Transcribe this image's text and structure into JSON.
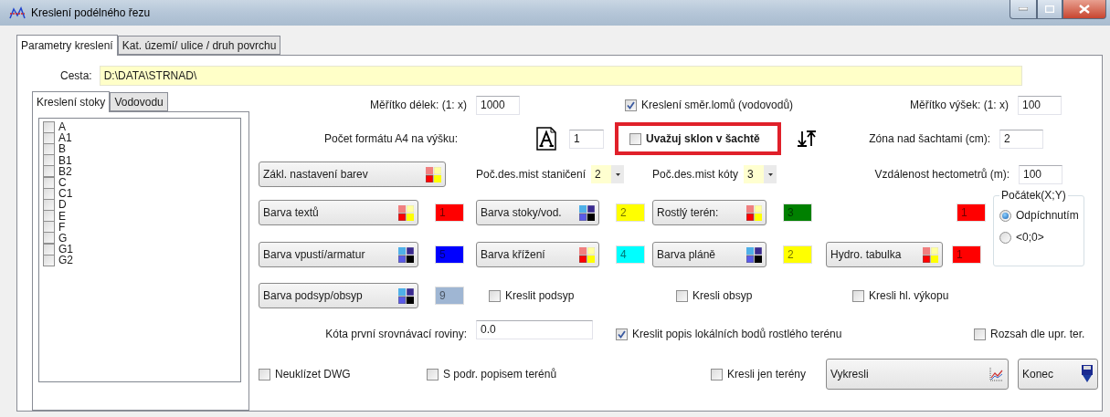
{
  "window": {
    "title": "Kreslení podélného řezu"
  },
  "tabs": [
    {
      "label": "Parametry kreslení",
      "selected": true
    },
    {
      "label": "Kat. území/ ulice / druh povrchu",
      "selected": false
    }
  ],
  "path": {
    "label": "Cesta:",
    "value": "D:\\DATA\\STRNAD\\"
  },
  "side_tabs": [
    {
      "label": "Kreslení  stoky",
      "selected": true
    },
    {
      "label": "Vodovodu",
      "selected": false
    }
  ],
  "layers": [
    {
      "label": "A",
      "checked": false
    },
    {
      "label": "A1",
      "checked": false
    },
    {
      "label": "B",
      "checked": false
    },
    {
      "label": "B1",
      "checked": false
    },
    {
      "label": "B2",
      "checked": false
    },
    {
      "label": "C",
      "checked": false
    },
    {
      "label": "C1",
      "checked": false
    },
    {
      "label": "D",
      "checked": false
    },
    {
      "label": "E",
      "checked": false
    },
    {
      "label": "F",
      "checked": false
    },
    {
      "label": "G",
      "checked": false
    },
    {
      "label": "G1",
      "checked": false
    },
    {
      "label": "G2",
      "checked": false
    }
  ],
  "scale_length": {
    "label": "Měřítko délek: (1:  x)",
    "value": "1000"
  },
  "direction_breaks": {
    "label": "Kreslení směr.lomů (vodovodů)",
    "checked": true
  },
  "scale_height": {
    "label": "Měřítko výšek: (1:  x)",
    "value": "100"
  },
  "a4_count": {
    "label": "Počet formátu A4 na výšku:",
    "value": "1"
  },
  "shaft_slope": {
    "label": "Uvažuj sklon v šachtě",
    "checked": false,
    "highlighted": true
  },
  "zone": {
    "label": "Zóna nad šachtami (cm):",
    "value": "2"
  },
  "base_colors_button": {
    "label": "Zákl. nastavení barev",
    "kind": "warm"
  },
  "station_decimals": {
    "label": "Poč.des.mist staničení",
    "value": "2"
  },
  "elevation_decimals": {
    "label": "Poč.des.mist kóty",
    "value": "3"
  },
  "hectometer": {
    "label": "Vzdálenost hectometrů (m):",
    "value": "100"
  },
  "color_rows": [
    [
      {
        "button": "Barva textů",
        "kind": "warm",
        "swatch": "1",
        "color": "#ff0000"
      },
      {
        "button": "Barva stoky/vod.",
        "kind": "cool",
        "swatch": "2",
        "color": "#ffff00"
      },
      {
        "button": "Rostlý terén:",
        "kind": "warm",
        "swatch": "3",
        "color": "#008000"
      },
      {
        "swatch": "1",
        "color": "#ff0000"
      }
    ],
    [
      {
        "button": "Barva vpustí/armatur",
        "kind": "cool",
        "swatch": "5",
        "color": "#0000ff"
      },
      {
        "button": "Barva křížení",
        "kind": "warm",
        "swatch": "4",
        "color": "#00ffff"
      },
      {
        "button": "Barva pláně",
        "kind": "cool",
        "swatch": "2",
        "color": "#ffff00"
      },
      {
        "button": "Hydro. tabulka",
        "kind": "warm",
        "swatch": "1",
        "color": "#ff0000"
      }
    ]
  ],
  "origin": {
    "title": "Počátek(X;Y)",
    "options": [
      {
        "label": "Odpíchnutím",
        "selected": true
      },
      {
        "label": "<0;0>",
        "selected": false
      }
    ]
  },
  "fill_row": {
    "button": "Barva podsyp/obsyp",
    "kind": "cool",
    "swatch": "9",
    "color": "#9fb6d3",
    "checks": [
      {
        "label": "Kreslit podsyp",
        "checked": false
      },
      {
        "label": "Kresli obsyp",
        "checked": false
      },
      {
        "label": "Kresli hl. výkopu",
        "checked": false
      }
    ]
  },
  "datum": {
    "label": "Kóta první srovnávací roviny:",
    "value": "0.0"
  },
  "local_points": {
    "label": "Kreslit popis lokálních bodů rostlého terénu",
    "checked": true
  },
  "range": {
    "label": "Rozsah dle upr. ter.",
    "checked": false
  },
  "bottom_checks": [
    {
      "label": "Neuklízet DWG",
      "checked": false
    },
    {
      "label": "S podr. popisem terénů",
      "checked": false
    },
    {
      "label": "Kresli jen terény",
      "checked": false
    }
  ],
  "buttons": [
    {
      "label": "Vykresli",
      "kind": "draw"
    },
    {
      "label": "Konec",
      "kind": "exit"
    }
  ]
}
